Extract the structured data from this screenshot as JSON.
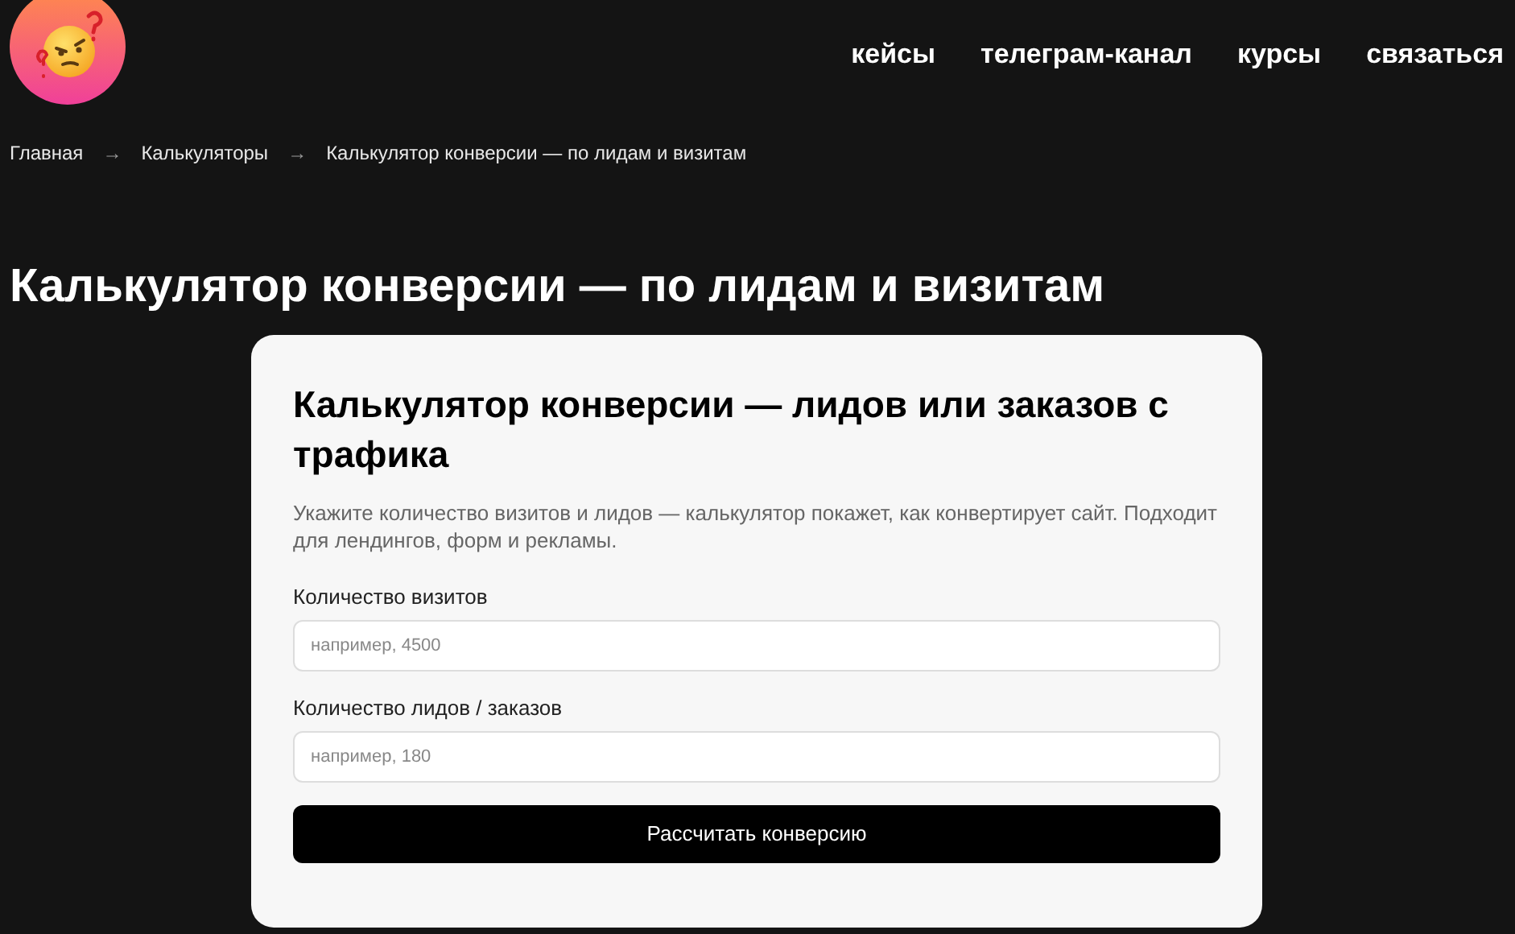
{
  "nav": [
    "кейсы",
    "телеграм-канал",
    "курсы",
    "связаться"
  ],
  "breadcrumbs": [
    {
      "label": "Главная",
      "separator": "→"
    },
    {
      "label": "Калькуляторы",
      "separator": "→"
    },
    {
      "label": "Калькулятор конверсии — по лидам и визитам"
    }
  ],
  "page_title": "Калькулятор конверсии — по лидам и визитам",
  "card": {
    "title": "Калькулятор конверсии — лидов или заказов с трафика",
    "description": "Укажите количество визитов и лидов — калькулятор покажет, как конвертирует сайт. Подходит для лендингов, форм и рекламы.",
    "fields": [
      {
        "label": "Количество визитов",
        "placeholder": "например, 4500"
      },
      {
        "label": "Количество лидов / заказов",
        "placeholder": "например, 180"
      }
    ],
    "button": "Рассчитать конверсию"
  }
}
